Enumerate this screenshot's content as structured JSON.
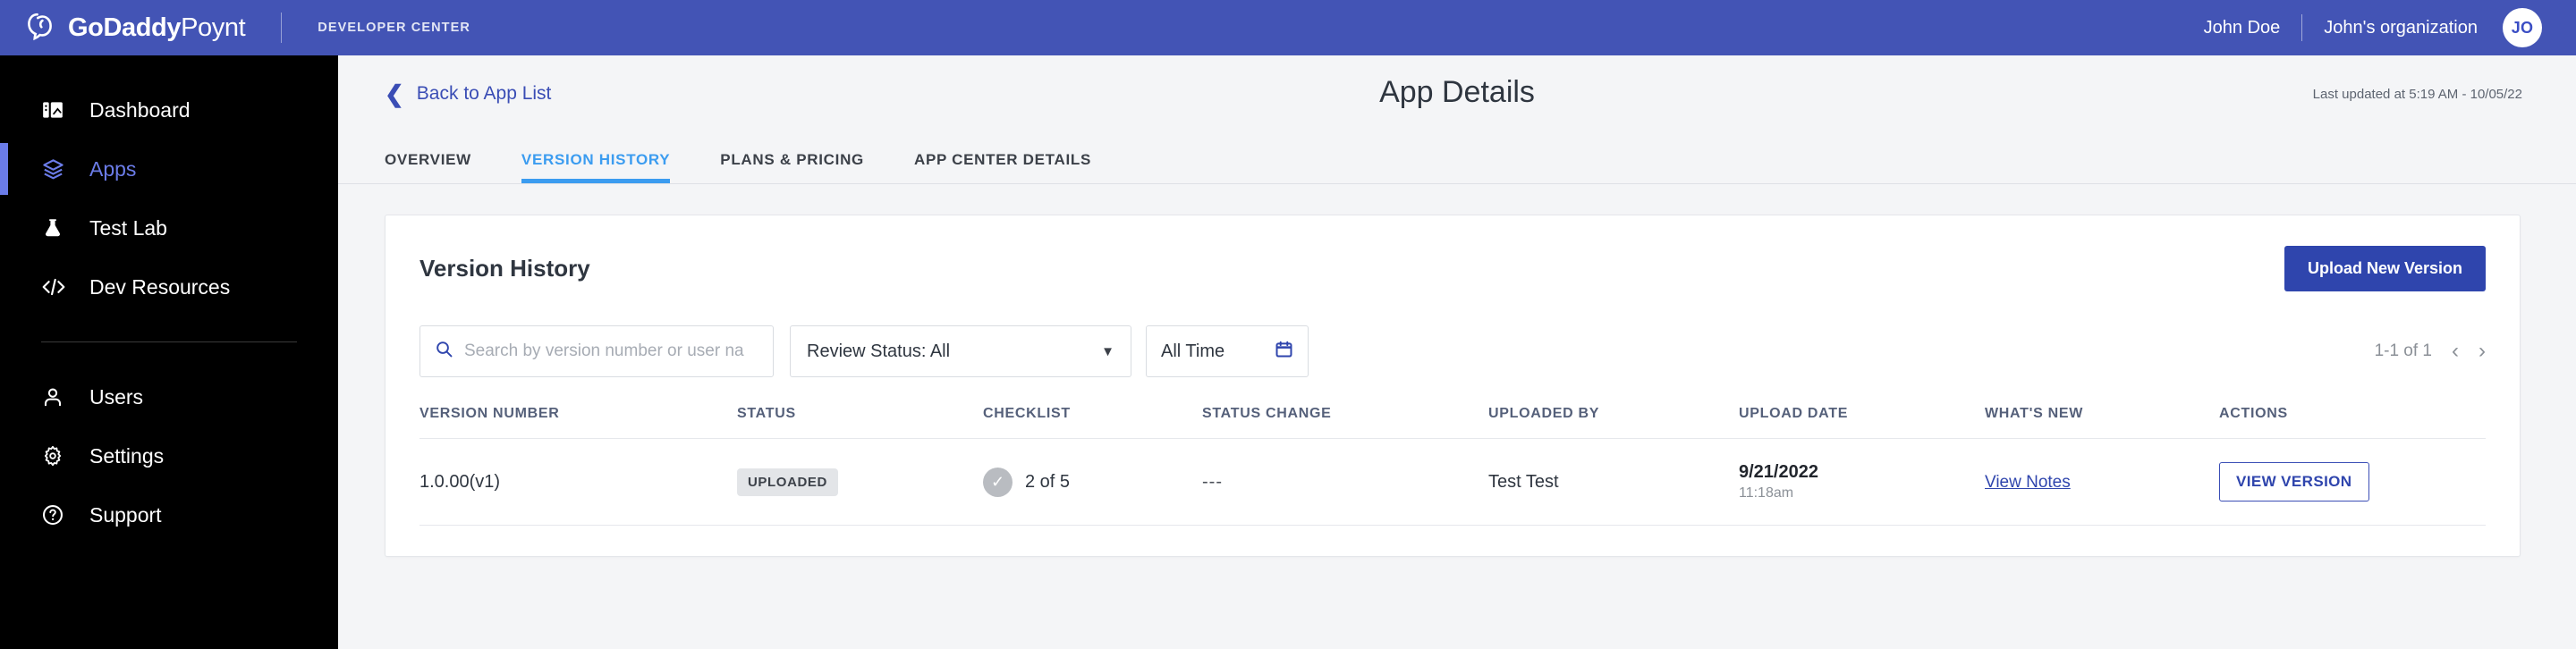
{
  "colors": {
    "topbar_blue": "#4354b5",
    "sidebar_black": "#000000",
    "accent_blue": "#2f45ad",
    "active_nav": "#6b7ce8",
    "tab_active": "#3b9cf0",
    "page_bg": "#f4f5f7"
  },
  "topbar": {
    "brand_bold": "GoDaddy",
    "brand_light": "Poynt",
    "section_label": "DEVELOPER CENTER",
    "user_name": "John Doe",
    "organization": "John's organization",
    "avatar_initials": "JO"
  },
  "sidebar": {
    "items": [
      {
        "label": "Dashboard",
        "icon": "dashboard-icon",
        "active": false
      },
      {
        "label": "Apps",
        "icon": "layers-icon",
        "active": true
      },
      {
        "label": "Test Lab",
        "icon": "flask-icon",
        "active": false
      },
      {
        "label": "Dev Resources",
        "icon": "code-icon",
        "active": false
      }
    ],
    "secondary_items": [
      {
        "label": "Users",
        "icon": "user-icon"
      },
      {
        "label": "Settings",
        "icon": "gear-icon"
      },
      {
        "label": "Support",
        "icon": "question-circle-icon"
      }
    ]
  },
  "page": {
    "back_label": "Back to App List",
    "back_icon": "chevron-left-icon",
    "title": "App Details",
    "last_updated": "Last updated at 5:19 AM - 10/05/22"
  },
  "tabs": [
    {
      "label": "OVERVIEW",
      "active": false
    },
    {
      "label": "VERSION HISTORY",
      "active": true
    },
    {
      "label": "PLANS & PRICING",
      "active": false
    },
    {
      "label": "APP CENTER DETAILS",
      "active": false
    }
  ],
  "card": {
    "title": "Version History",
    "upload_button": "Upload New Version"
  },
  "filters": {
    "search_icon": "search-icon",
    "search_value": "",
    "search_placeholder": "Search by version number or user na",
    "review_status_value": "Review Status: All",
    "review_status_chevron": "chevron-down-icon",
    "date_value": "All Time",
    "date_icon": "calendar-icon"
  },
  "pagination": {
    "range": "1-1 of 1",
    "prev_icon": "chevron-left-icon",
    "next_icon": "chevron-right-icon"
  },
  "table": {
    "headers": [
      "VERSION NUMBER",
      "STATUS",
      "CHECKLIST",
      "STATUS CHANGE",
      "UPLOADED BY",
      "UPLOAD DATE",
      "WHAT'S NEW",
      "ACTIONS"
    ],
    "rows": [
      {
        "version_number": "1.0.00(v1)",
        "status": "UPLOADED",
        "checklist_icon": "check-circle-icon",
        "checklist": "2 of 5",
        "status_change": "---",
        "uploaded_by": "Test Test",
        "upload_date": "9/21/2022",
        "upload_time": "11:18am",
        "whats_new": "View Notes",
        "action": "VIEW VERSION"
      }
    ]
  }
}
